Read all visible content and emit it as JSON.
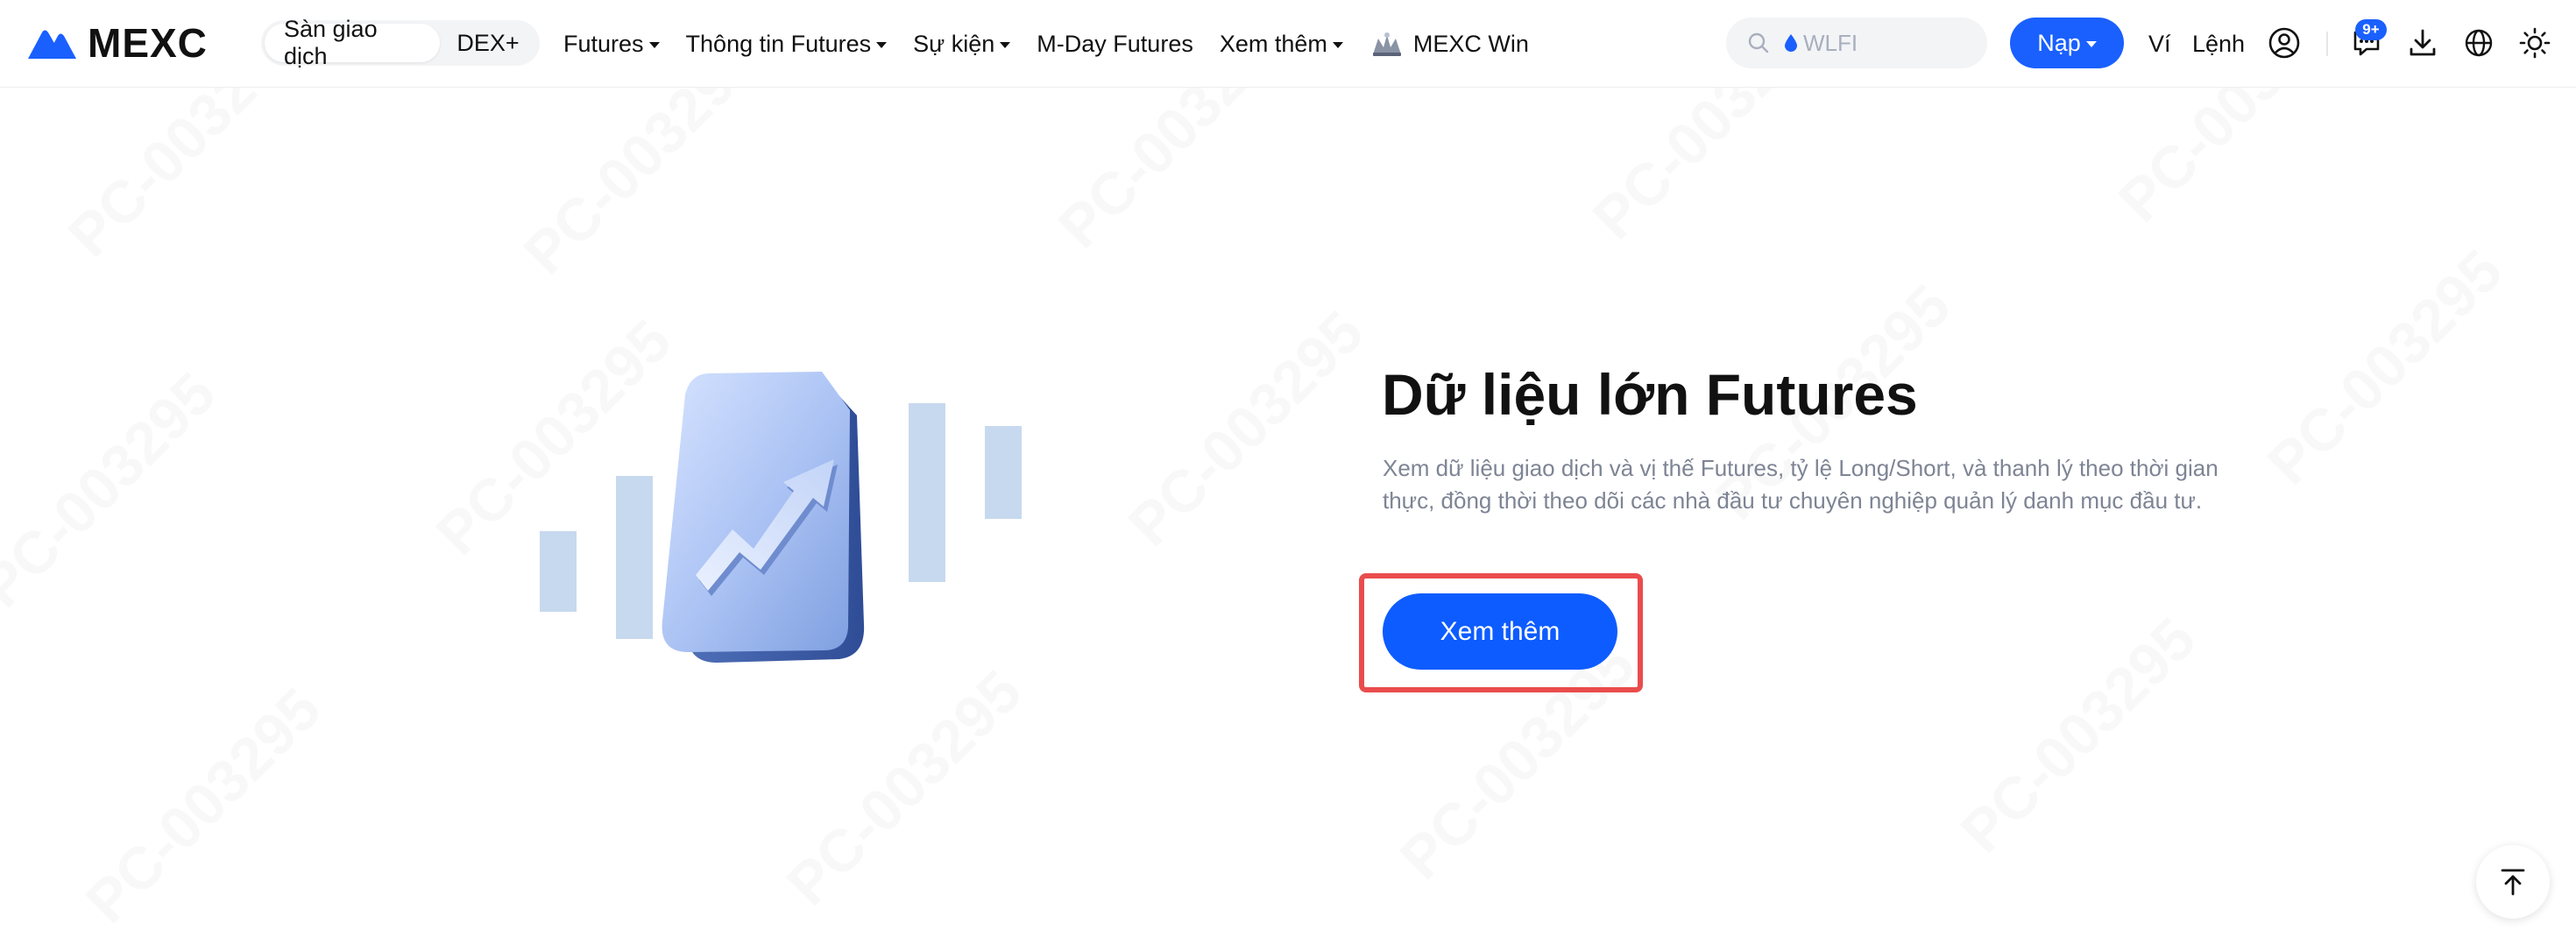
{
  "brand": {
    "name": "MEXC",
    "accent": "#1a60ff"
  },
  "header": {
    "segment": [
      {
        "label": "Sàn giao dịch",
        "active": true
      },
      {
        "label": "DEX+",
        "active": false
      }
    ],
    "nav": [
      {
        "label": "Futures",
        "dropdown": true
      },
      {
        "label": "Thông tin Futures",
        "dropdown": true
      },
      {
        "label": "Sự kiện",
        "dropdown": true
      },
      {
        "label": "M-Day Futures",
        "dropdown": false
      },
      {
        "label": "Xem thêm",
        "dropdown": true
      },
      {
        "label": "MEXC Win",
        "dropdown": false,
        "icon": "mexc-win-icon"
      }
    ],
    "search": {
      "placeholder": "WLFI",
      "icon": "search-icon"
    },
    "deposit_label": "Nạp",
    "wallet_label": "Ví",
    "orders_label": "Lệnh",
    "notification_badge": "9+",
    "icons": [
      "user-icon",
      "notification-icon",
      "download-icon",
      "globe-icon",
      "theme-sun-icon"
    ]
  },
  "hero": {
    "title": "Dữ liệu lớn Futures",
    "description": "Xem dữ liệu giao dịch và vị thế Futures, tỷ lệ Long/Short, và thanh lý theo thời gian thực, đồng thời theo dõi các nhà đầu tư chuyên nghiệp quản lý danh mục đầu tư.",
    "button_label": "Xem thêm",
    "highlight_color": "#ea4c4c"
  },
  "watermark": "PC-003295",
  "back_to_top_icon": "arrow-up-to-line-icon"
}
